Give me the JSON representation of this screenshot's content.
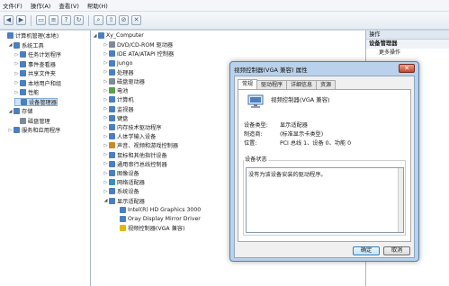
{
  "menu": [
    "文件(F)",
    "操作(A)",
    "查看(V)",
    "帮助(H)"
  ],
  "toolbar_icons": [
    "back-icon",
    "forward-icon",
    "folder-icon",
    "properties-icon",
    "help-icon",
    "refresh-icon",
    "scan-hardware-icon",
    "update-driver-icon",
    "disable-device-icon",
    "uninstall-device-icon"
  ],
  "left_tree": [
    {
      "label": "计算机管理(本地)",
      "level": 0,
      "icon": "computer-management-icon",
      "exp": ""
    },
    {
      "label": "系统工具",
      "level": 1,
      "icon": "tools-icon",
      "exp": "◢"
    },
    {
      "label": "任务计划程序",
      "level": 2,
      "icon": "task-scheduler-icon",
      "exp": "▷"
    },
    {
      "label": "事件查看器",
      "level": 2,
      "icon": "event-viewer-icon",
      "exp": "▷"
    },
    {
      "label": "共享文件夹",
      "level": 2,
      "icon": "shared-folder-icon",
      "exp": "▷"
    },
    {
      "label": "本地用户和组",
      "level": 2,
      "icon": "users-icon",
      "exp": "▷"
    },
    {
      "label": "性能",
      "level": 2,
      "icon": "performance-icon",
      "exp": "▷"
    },
    {
      "label": "设备管理器",
      "level": 2,
      "icon": "device-manager-icon",
      "exp": "",
      "selected": true
    },
    {
      "label": "存储",
      "level": 1,
      "icon": "storage-icon",
      "exp": "◢"
    },
    {
      "label": "磁盘管理",
      "level": 2,
      "icon": "disk-icon",
      "exp": ""
    },
    {
      "label": "服务和应用程序",
      "level": 1,
      "icon": "services-icon",
      "exp": "▷"
    }
  ],
  "device_tree": [
    {
      "label": "Xy_Computer",
      "level": 0,
      "icon": "computer-icon",
      "exp": "◢"
    },
    {
      "label": "DVD/CD-ROM 驱动器",
      "level": 1,
      "icon": "dvd-icon",
      "exp": "▷"
    },
    {
      "label": "IDE ATA/ATAPI 控制器",
      "level": 1,
      "icon": "ide-icon",
      "exp": "▷"
    },
    {
      "label": "Jungo",
      "level": 1,
      "icon": "jungo-icon",
      "exp": "▷"
    },
    {
      "label": "处理器",
      "level": 1,
      "icon": "processor-icon",
      "exp": "▷"
    },
    {
      "label": "磁盘驱动器",
      "level": 1,
      "icon": "disk-drive-icon",
      "exp": "▷"
    },
    {
      "label": "电池",
      "level": 1,
      "icon": "battery-icon",
      "exp": "▷"
    },
    {
      "label": "计算机",
      "level": 1,
      "icon": "computer-small-icon",
      "exp": "▷"
    },
    {
      "label": "监视器",
      "level": 1,
      "icon": "monitor-icon",
      "exp": "▷"
    },
    {
      "label": "键盘",
      "level": 1,
      "icon": "keyboard-icon",
      "exp": "▷"
    },
    {
      "label": "内存技术驱动程序",
      "level": 1,
      "icon": "memory-icon",
      "exp": "▷"
    },
    {
      "label": "人体学输入设备",
      "level": 1,
      "icon": "hid-icon",
      "exp": "▷"
    },
    {
      "label": "声音、视频和游戏控制器",
      "level": 1,
      "icon": "sound-icon",
      "exp": "▷"
    },
    {
      "label": "鼠标和其他指针设备",
      "level": 1,
      "icon": "mouse-icon",
      "exp": "▷"
    },
    {
      "label": "通用串行总线控制器",
      "level": 1,
      "icon": "usb-icon",
      "exp": "▷"
    },
    {
      "label": "图像设备",
      "level": 1,
      "icon": "camera-icon",
      "exp": "▷"
    },
    {
      "label": "网络适配器",
      "level": 1,
      "icon": "network-icon",
      "exp": "▷"
    },
    {
      "label": "系统设备",
      "level": 1,
      "icon": "system-device-icon",
      "exp": "▷"
    },
    {
      "label": "显示适配器",
      "level": 1,
      "icon": "display-adapter-icon",
      "exp": "◢"
    },
    {
      "label": "Intel(R) HD Graphics 3000",
      "level": 2,
      "icon": "display-icon",
      "exp": ""
    },
    {
      "label": "Oray Display Mirror Driver",
      "level": 2,
      "icon": "display-icon",
      "exp": ""
    },
    {
      "label": "视频控制器(VGA 兼容)",
      "level": 2,
      "icon": "display-warning-icon",
      "exp": ""
    }
  ],
  "actions": {
    "header": "操作",
    "section": "设备管理器",
    "item": "更多操作"
  },
  "dialog": {
    "title": "视频控制器(VGA 兼容) 属性",
    "tabs": [
      "常规",
      "驱动程序",
      "详细信息",
      "资源"
    ],
    "device_name": "视频控制器(VGA 兼容)",
    "props": [
      {
        "label": "设备类型:",
        "value": "显示适配器"
      },
      {
        "label": "制造商:",
        "value": "(标准显示卡类型)"
      },
      {
        "label": "位置:",
        "value": "PCI 总线 1、设备 0、功能 0"
      }
    ],
    "status_label": "设备状态",
    "status_text": "没有为该设备安装的驱动程序。",
    "ok": "确定",
    "cancel": "取消"
  },
  "colors": {
    "accent": "#3c7fb1",
    "selected": "#cfe3f8",
    "icon_blue": "#4a7fc1",
    "icon_warning": "#e6b800"
  }
}
